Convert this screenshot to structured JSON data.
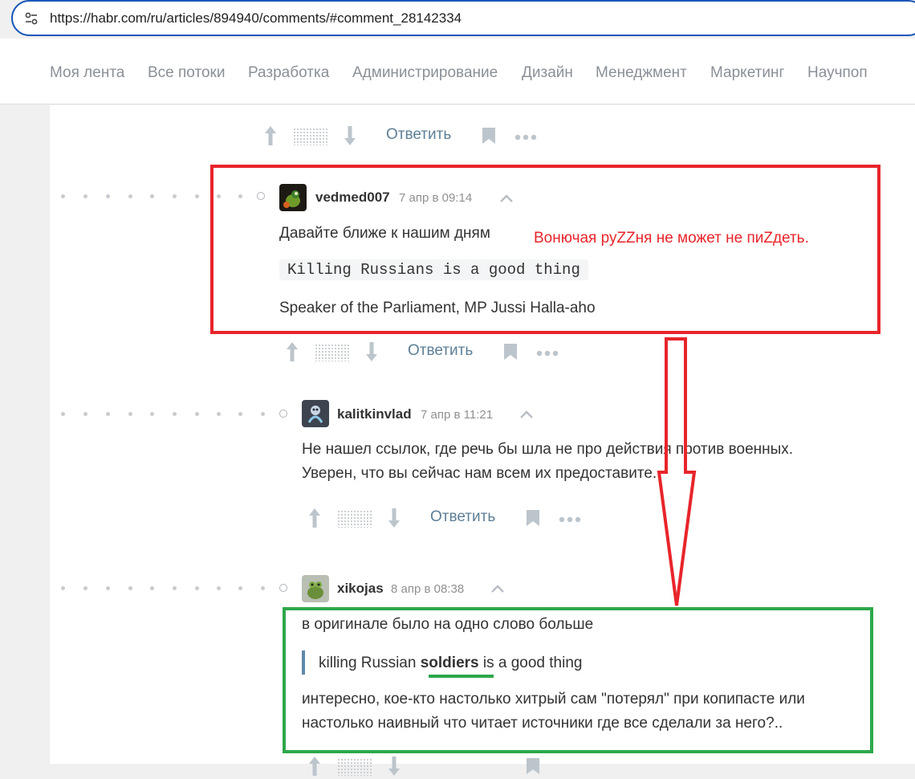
{
  "browser": {
    "url": "https://habr.com/ru/articles/894940/comments/#comment_28142334",
    "site_info_icon": "tune-icon"
  },
  "nav": {
    "items": [
      "Моя лента",
      "Все потоки",
      "Разработка",
      "Администрирование",
      "Дизайн",
      "Менеджмент",
      "Маркетинг",
      "Научпоп"
    ]
  },
  "actions_labels": {
    "reply": "Ответить"
  },
  "comments": [
    {
      "author": "vedmed007",
      "time": "7 апр в 09:14",
      "text": "Давайте ближе к нашим дням",
      "code": "Killing Russians is a good thing",
      "text2": "Speaker of the Parliament, MP Jussi Halla-aho"
    },
    {
      "author": "kalitkinvlad",
      "time": "7 апр в 11:21",
      "text_line1": "Не нашел ссылок, где речь бы шла не про действия против военных.",
      "text_line2": "Уверен, что вы сейчас нам всем их предоставите."
    },
    {
      "author": "xikojas",
      "time": "8 апр в 08:38",
      "text": "в оригинале было на одно слово больше",
      "quote_before": "killing Russian ",
      "quote_bold": "soldiers",
      "quote_after": " is a good thing",
      "text_line1": "интересно, кое-кто настолько хитрый сам \"потерял\" при копипасте или",
      "text_line2": "настолько наивный что читает источники где все сделали за него?.."
    }
  ],
  "annotation": {
    "text": "Вонючая руZZня не может не пиZдеть.",
    "red_color": "#e8252b",
    "green_color": "#2ea84a"
  }
}
